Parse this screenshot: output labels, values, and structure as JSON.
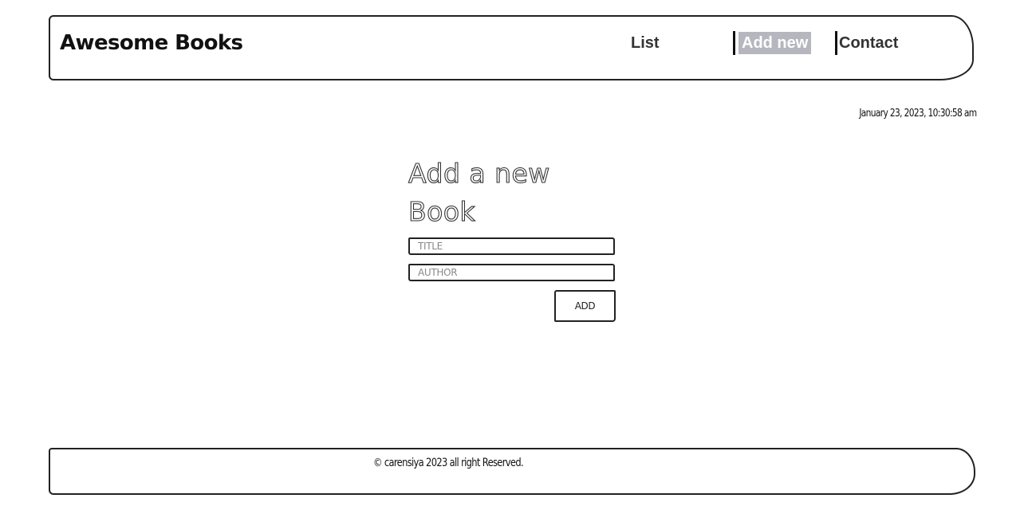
{
  "header": {
    "brand": "Awesome Books",
    "nav": {
      "list_label": "List",
      "add_new_label": "Add new",
      "contact_label": "Contact",
      "active": "Add new"
    }
  },
  "datetime": "January 23, 2023, 10:30:58 am",
  "form": {
    "title": "Add a new Book",
    "title_placeholder": "TITLE",
    "author_placeholder": "AUTHOR",
    "title_value": "",
    "author_value": "",
    "add_label": "ADD"
  },
  "footer": {
    "text": "© carensiya 2023 all right Reserved."
  },
  "colors": {
    "active_nav_bg": "#b6b6bf",
    "active_nav_text": "#ffffff",
    "border": "#222222"
  }
}
